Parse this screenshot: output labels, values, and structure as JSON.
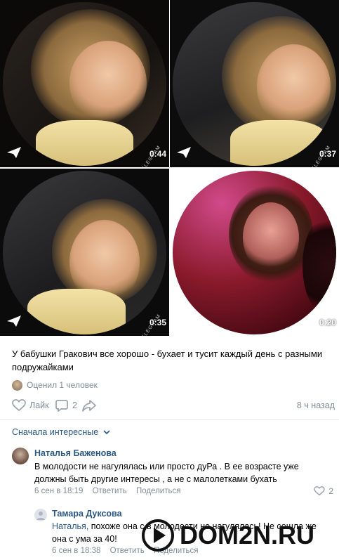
{
  "videos": [
    {
      "duration": "0:44",
      "watermark": "TELEGRAM",
      "bg": "#1d1a18"
    },
    {
      "duration": "0:37",
      "watermark": "TELEGRAM",
      "bg": "#2a2a2c"
    },
    {
      "duration": "0:35",
      "watermark": "TELEGRAM",
      "bg": "#232325"
    },
    {
      "duration": "0:20",
      "watermark": "",
      "bg": "#6b1024"
    }
  ],
  "post": {
    "text": "У бабушки Гракович все хорошо - бухает и тусит каждый день с разными подружайками",
    "rated_text": "Оценил 1 человек",
    "like_label": "Лайк",
    "comments_count": "2",
    "time": "8 ч назад"
  },
  "comments": {
    "sort_label": "Сначала интересные",
    "items": [
      {
        "author": "Наталья Баженова",
        "text": "В молодости не нагулялась или просто дуРа . В ее возрасте уже должны быть другие интересы , а не с малолетками бухать",
        "date": "6 сен в 18:19",
        "reply_label": "Ответить",
        "share_label": "Поделиться",
        "likes": "2"
      },
      {
        "author": "Тамара Дуксова",
        "mention": "Наталья,",
        "text": " похоже она с в молодости не нагулялась! Не сошла же она с ума за 40!",
        "date": "6 сен в 18:38",
        "reply_label": "Ответить",
        "share_label": "Поделиться"
      }
    ]
  },
  "watermark_logo": "DOM2N.RU",
  "colors": {
    "link": "#2a5885",
    "muted": "#818c99",
    "icon": "#99a2ad"
  }
}
